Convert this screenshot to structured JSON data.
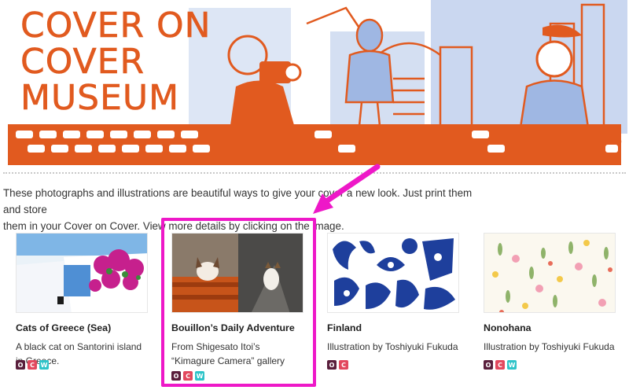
{
  "banner": {
    "title_lines": [
      "COVER ON",
      "COVER",
      "MUSEUM"
    ],
    "colors": {
      "orange": "#e15a1f",
      "blue": "#9fb7e3"
    }
  },
  "intro": {
    "line1": "These photographs and illustrations are beautiful ways to give your cover a new look. Just print them and store",
    "line2": "them in your Cover on Cover. View more details by clicking on the image."
  },
  "cards": [
    {
      "title": "Cats of Greece (Sea)",
      "desc_line1": "A black cat on Santorini island",
      "desc_line2": "in Greece.",
      "badges": [
        "O",
        "C",
        "W"
      ]
    },
    {
      "title": "Bouillon’s Daily Adventure",
      "desc_line1": "From Shigesato Itoi’s",
      "desc_line2": "“Kimagure Camera” gallery",
      "badges": [
        "O",
        "C",
        "W"
      ]
    },
    {
      "title": "Finland",
      "desc_line1": "Illustration by Toshiyuki Fukuda",
      "desc_line2": "",
      "badges": [
        "O",
        "C"
      ]
    },
    {
      "title": "Nonohana",
      "desc_line1": "Illustration by Toshiyuki Fukuda",
      "desc_line2": "",
      "badges": [
        "O",
        "C",
        "W"
      ]
    }
  ],
  "annotation": {
    "highlight_color": "#ee18c8"
  },
  "icons": [
    "arrow-icon"
  ]
}
